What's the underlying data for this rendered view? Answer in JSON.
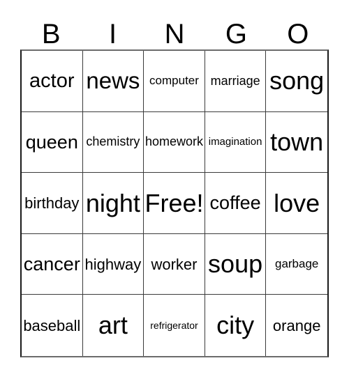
{
  "card": {
    "header_letters": [
      "B",
      "I",
      "N",
      "G",
      "O"
    ],
    "free_space_label": "Free!",
    "rows": [
      [
        "actor",
        "news",
        "computer",
        "marriage",
        "song"
      ],
      [
        "queen",
        "chemistry",
        "homework",
        "imagination",
        "town"
      ],
      [
        "birthday",
        "night",
        "Free!",
        "coffee",
        "love"
      ],
      [
        "cancer",
        "highway",
        "worker",
        "soup",
        "garbage"
      ],
      [
        "baseball",
        "art",
        "refrigerator",
        "city",
        "orange"
      ]
    ],
    "colors": {
      "background": "#ffffff",
      "text": "#000000",
      "grid_line": "#3a3a3a",
      "outer_border": "#1a1a1a"
    }
  }
}
